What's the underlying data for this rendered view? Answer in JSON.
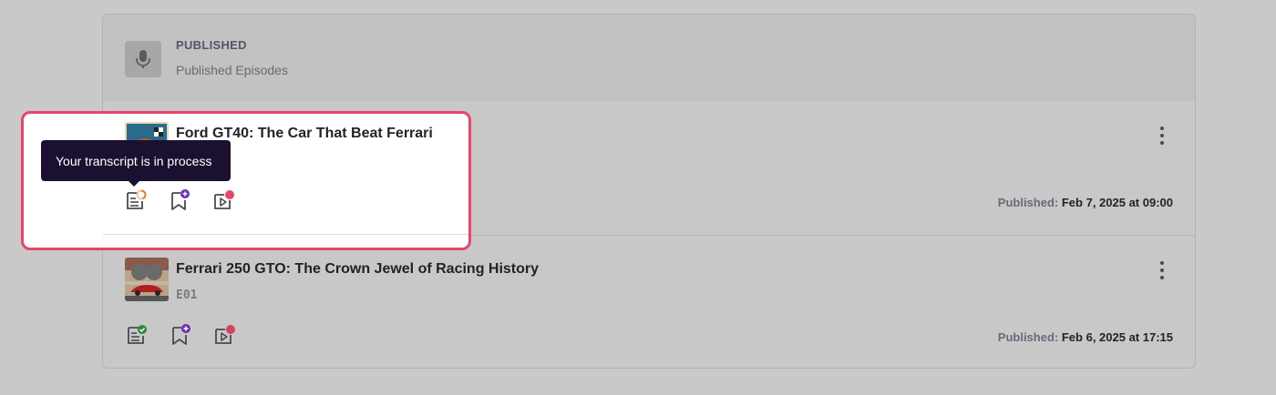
{
  "header": {
    "title": "PUBLISHED",
    "subtitle": "Published Episodes",
    "icon": "microphone-icon"
  },
  "episodes": [
    {
      "title": "Ford GT40: The Car That Beat Ferrari",
      "code": "",
      "published_label": "Published:",
      "published_date": "Feb 7, 2025 at 09:00",
      "transcript_status": "in-process"
    },
    {
      "title": "Ferrari 250 GTO: The Crown Jewel of Racing History",
      "code": "E01",
      "published_label": "Published:",
      "published_date": "Feb 6, 2025 at 17:15",
      "transcript_status": "done"
    }
  ],
  "tooltip": {
    "text": "Your transcript is in process"
  },
  "colors": {
    "highlight_border": "#e8456a",
    "tooltip_bg": "#1c1030",
    "badge_purple": "#6a2fb8",
    "badge_pink": "#e8456a",
    "badge_green": "#2a8a3a",
    "progress_orange": "#f07a1a"
  }
}
